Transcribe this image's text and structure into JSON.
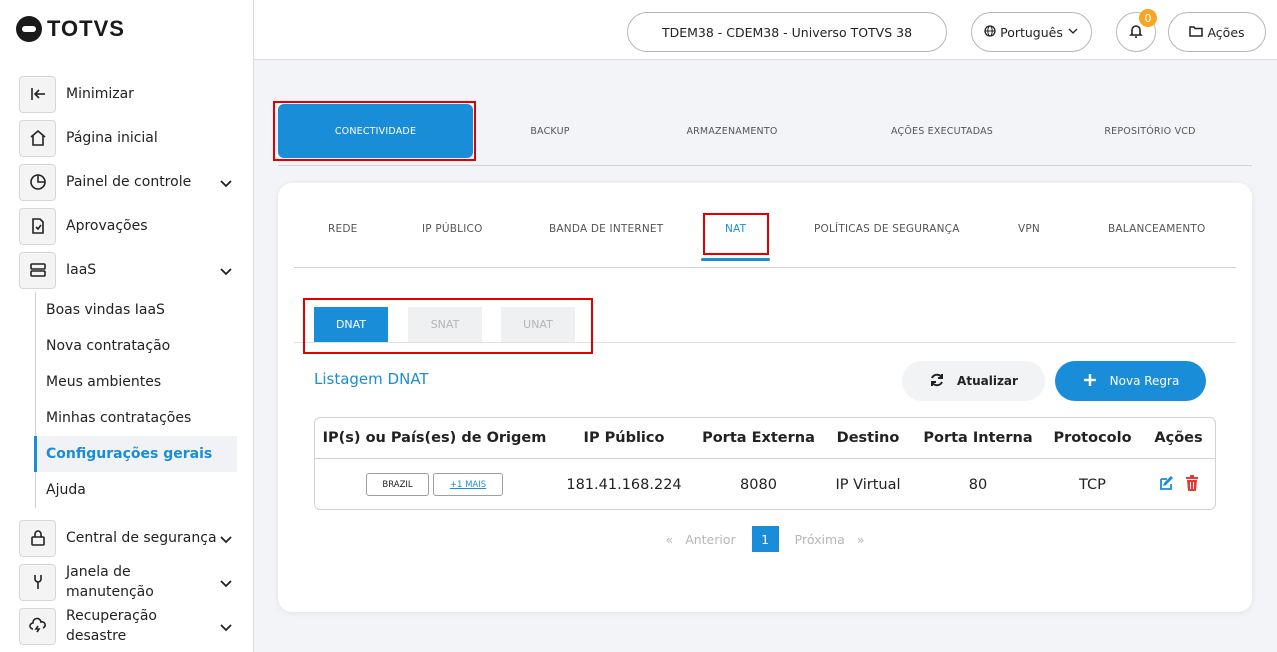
{
  "app": {
    "brand": "TOTVS"
  },
  "header": {
    "environment": "TDEM38 - CDEM38 - Universo TOTVS 38",
    "language": "Português",
    "notifications_count": "0",
    "actions_label": "Ações"
  },
  "sidebar": {
    "minimize": "Minimizar",
    "items": [
      {
        "label": "Página inicial",
        "icon": "home-icon"
      },
      {
        "label": "Painel de controle",
        "icon": "pie-chart-icon"
      },
      {
        "label": "Aprovações",
        "icon": "document-check-icon"
      },
      {
        "label": "IaaS",
        "icon": "server-icon"
      },
      {
        "label": "Central de segurança",
        "icon": "lock-icon"
      },
      {
        "label": "Janela de manutenção",
        "icon": "wrench-icon"
      },
      {
        "label": "Recuperação desastre",
        "icon": "cloud-lightning-icon"
      }
    ],
    "iaas_sub": [
      "Boas vindas IaaS",
      "Nova contratação",
      "Meus ambientes",
      "Minhas contratações",
      "Configurações gerais",
      "Ajuda"
    ],
    "active_sub": "Configurações gerais"
  },
  "main_tabs": [
    "CONECTIVIDADE",
    "BACKUP",
    "ARMAZENAMENTO",
    "AÇÕES EXECUTADAS",
    "REPOSITÓRIO VCD"
  ],
  "active_main_tab": "CONECTIVIDADE",
  "sub_tabs": [
    "REDE",
    "IP PÚBLICO",
    "BANDA DE INTERNET",
    "NAT",
    "POLÍTICAS DE SEGURANÇA",
    "VPN",
    "BALANCEAMENTO"
  ],
  "active_sub_tab": "NAT",
  "inner_tabs": [
    "DNAT",
    "SNAT",
    "UNAT"
  ],
  "active_inner_tab": "DNAT",
  "list": {
    "title": "Listagem DNAT",
    "refresh_label": "Atualizar",
    "new_rule_label": "Nova Regra"
  },
  "table": {
    "headers": [
      "IP(s) ou País(es) de Origem",
      "IP Público",
      "Porta Externa",
      "Destino",
      "Porta Interna",
      "Protocolo",
      "Ações"
    ],
    "rows": [
      {
        "origin_chip": "BRAZIL",
        "origin_more": "+1 MAIS",
        "public_ip": "181.41.168.224",
        "external_port": "8080",
        "destination": "IP Virtual",
        "internal_port": "80",
        "protocol": "TCP"
      }
    ]
  },
  "pagination": {
    "prev": "Anterior",
    "next": "Próxima",
    "current_page": "1",
    "first_glyph": "«",
    "last_glyph": "»"
  },
  "colors": {
    "accent": "#1a8dd8",
    "highlight": "#e10000",
    "badge": "#f5a623",
    "trash": "#e53935"
  }
}
